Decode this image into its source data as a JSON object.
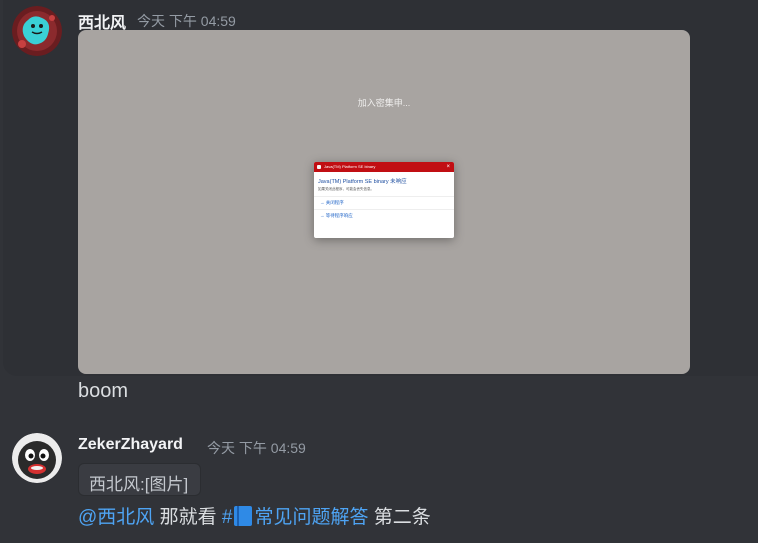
{
  "message1": {
    "username": "西北风",
    "timestamp": "今天 下午 04:59",
    "attachment": {
      "loading_text": "加入密集申...",
      "dialog": {
        "title": "Java(TM) Platform SE binary",
        "close_glyph": "×",
        "heading": "Java(TM) Platform SE binary 未响应",
        "subtext": "如果关闭此程序，可能会丢失信息。",
        "options": [
          "→ 关闭程序",
          "→ 等待程序响应"
        ]
      }
    },
    "followup_text": "boom"
  },
  "message2": {
    "username": "ZekerZhayard",
    "timestamp": "今天 下午 04:59",
    "reply_chip": "西北风:[图片]",
    "mention": "@西北风",
    "text_mid": " 那就看 ",
    "channel_hash": "#",
    "channel_name": "常见问题解答",
    "text_end": " 第二条"
  },
  "colors": {
    "background": "#313338",
    "hover_background": "#2e3035",
    "username": "#f2f3f5",
    "timestamp": "#949ba4",
    "link": "#4ea4f4",
    "dialog_titlebar": "#c10e13"
  }
}
